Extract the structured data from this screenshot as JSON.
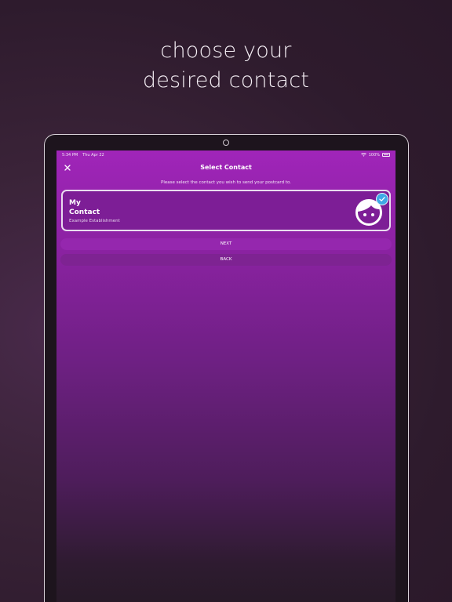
{
  "headline": {
    "line1": "choose your",
    "line2": "desired contact"
  },
  "status_bar": {
    "time": "5:34 PM",
    "date": "Thu Apr 22",
    "battery": "100%",
    "icons": [
      "wifi-icon",
      "battery-icon"
    ]
  },
  "nav": {
    "title": "Select Contact",
    "close_icon": "close-icon"
  },
  "instruction": "Please select the contact you wish to send your postcard to.",
  "contact": {
    "name_line1": "My",
    "name_line2": "Contact",
    "establishment": "Example Establishment",
    "selected": true,
    "avatar_icon": "face-avatar-icon",
    "badge_icon": "checkmark-icon"
  },
  "buttons": {
    "next": "NEXT",
    "back": "BACK"
  },
  "colors": {
    "accent": "#a025b9",
    "card": "#7d1e96",
    "check_badge": "#3fa9e6",
    "background": "#2e1b2d"
  }
}
